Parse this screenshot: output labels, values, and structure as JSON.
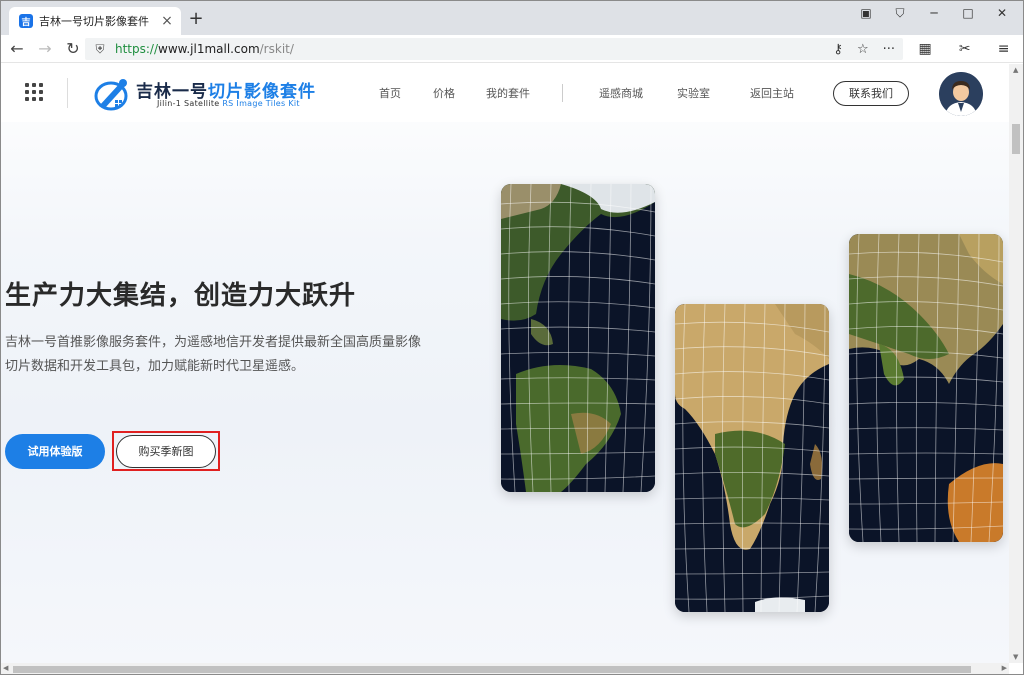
{
  "browser": {
    "tab_title": "吉林一号切片影像套件",
    "tab_favicon": "吉",
    "url_scheme": "https://",
    "url_host": "www.jl1mall.com",
    "url_path": "/rskit/",
    "icons": {
      "back": "back-arrow-icon",
      "forward": "forward-arrow-icon",
      "reload": "reload-icon",
      "shield": "shield-icon",
      "key": "key-icon",
      "star": "star-icon",
      "more": "more-icon",
      "apps": "apps-grid-icon",
      "scissors": "scissors-icon",
      "menu": "hamburger-menu-icon"
    }
  },
  "header": {
    "logo_title_dark": "吉林一号",
    "logo_title_blue": "切片影像套件",
    "logo_sub_dark": "Jilin-1  Satellite ",
    "logo_sub_blue": "RS Image Tiles Kit",
    "nav": [
      {
        "label": "首页"
      },
      {
        "label": "价格"
      },
      {
        "label": "我的套件"
      },
      {
        "label": "遥感商城"
      },
      {
        "label": "实验室"
      },
      {
        "label": "返回主站"
      }
    ],
    "contact_label": "联系我们"
  },
  "hero": {
    "title": "生产力大集结，创造力大跃升",
    "description": "吉林一号首推影像服务套件，为遥感地信开发者提供最新全国高质量影像切片数据和开发工具包，加力赋能新时代卫星遥感。",
    "trial_button": "试用体验版",
    "buy_button": "购买季新图"
  },
  "colors": {
    "brand_blue": "#1d7fe6",
    "highlight_red": "#e02020",
    "ocean": "#0b1428"
  }
}
